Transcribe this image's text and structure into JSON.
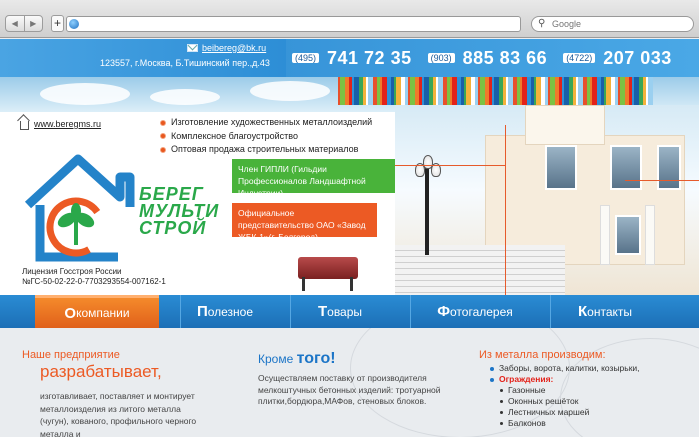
{
  "browser": {
    "search_placeholder": "Google",
    "nav_back": "◀",
    "nav_forward": "▶",
    "new_tab": "+"
  },
  "header": {
    "email": "beibereg@bk.ru",
    "address": "123557, г.Москва, Б.Тишинский пер.,д.43",
    "phones": [
      {
        "code": "(495)",
        "number": "741 72 35"
      },
      {
        "code": "(903)",
        "number": "885 83 66"
      },
      {
        "code": "(4722)",
        "number": "207 033"
      }
    ]
  },
  "banner": {
    "site": "www.beregms.ru",
    "services": [
      "Изготовление художественных металлоизделий",
      "Комплексное благоустройство",
      "Оптовая продажа строительных материалов"
    ],
    "logo_lines": [
      "БЕРЕГ",
      "МУЛЬТИ",
      "СТРОЙ"
    ],
    "license_line1": "Лицензия Госстроя России",
    "license_line2": "№ГС-50-02-22-0-7703293554-007162-1",
    "badge_green": "Член ГИПЛИ (Гильдии Профессионалов Ландшафтной Индустрии)",
    "badge_orange": "Официальное представительство ОАО «Завод ЖБК-1»(г. Белгород)"
  },
  "menu": {
    "items": [
      {
        "first": "О",
        "rest": " компании"
      },
      {
        "first": "П",
        "rest": "олезное"
      },
      {
        "first": "Т",
        "rest": "овары"
      },
      {
        "first": "Ф",
        "rest": "отогалерея"
      },
      {
        "first": "К",
        "rest": "онтакты"
      }
    ]
  },
  "content": {
    "col1_heading1": "Наше предприятие",
    "col1_heading2": "разрабатывает,",
    "col1_text": "изготавливает, поставляет и монтирует металлоизделия из литого металла (чугун), кованого, профильного черного металла и",
    "col2_heading_a": "Кроме ",
    "col2_heading_b": "того!",
    "col2_text": "Осуществляем поставку от производителя мелкоштучных бетонных изделий: тротуарной плитки,бордюра,МАФов, стеновых блоков.",
    "col3_heading": "Из металла производим:",
    "col3_item1": "Заборы, ворота, калитки, козырьки,",
    "col3_item2": "Ограждения:",
    "col3_sub": [
      "Газонные",
      "Оконных решёток",
      "Лестничных маршей",
      "Балконов"
    ]
  },
  "colors": {
    "brand_blue": "#2a87cf",
    "brand_orange": "#ec5a24",
    "brand_green": "#49b33a"
  }
}
